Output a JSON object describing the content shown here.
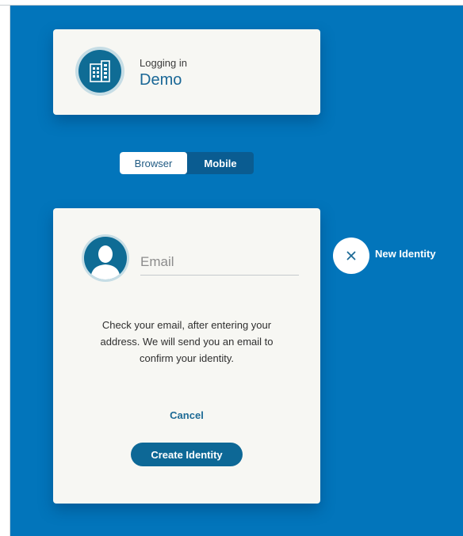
{
  "login_card": {
    "label": "Logging in",
    "org_name": "Demo",
    "icon": "building-icon"
  },
  "mode_toggle": {
    "options": [
      "Browser",
      "Mobile"
    ],
    "selected": "Browser"
  },
  "identity_form": {
    "avatar_icon": "user-silhouette-icon",
    "email": {
      "placeholder": "Email",
      "value": ""
    },
    "instructions": "Check your email, after entering your address. We will send you an email to confirm your identity.",
    "cancel_label": "Cancel",
    "create_label": "Create Identity"
  },
  "side_action": {
    "icon": "close-icon",
    "label": "New Identity"
  },
  "colors": {
    "background": "#0275bb",
    "card": "#f7f7f3",
    "primary": "#0d6896",
    "link": "#1d6a95"
  }
}
